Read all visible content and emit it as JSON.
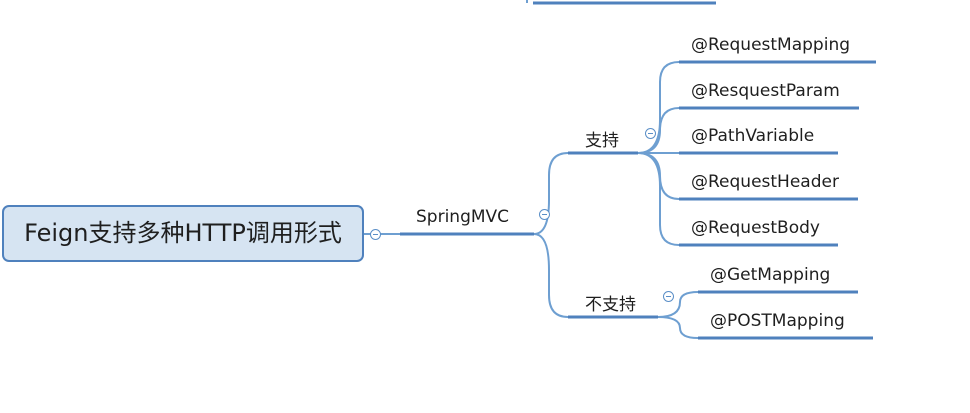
{
  "root": {
    "label": "Feign支持多种HTTP调用形式"
  },
  "springmvc": {
    "label": "SpringMVC"
  },
  "supported": {
    "label": "支持",
    "items": [
      "@RequestMapping",
      "@ResquestParam",
      "@PathVariable",
      "@RequestHeader",
      "@RequestBody"
    ]
  },
  "unsupported": {
    "label": "不支持",
    "items": [
      "@GetMapping",
      "@POSTMapping"
    ]
  },
  "colors": {
    "line": "#6e9fd1",
    "underline": "#4f81bd",
    "root_fill": "#d6e4f2",
    "root_border": "#4f81bd"
  }
}
